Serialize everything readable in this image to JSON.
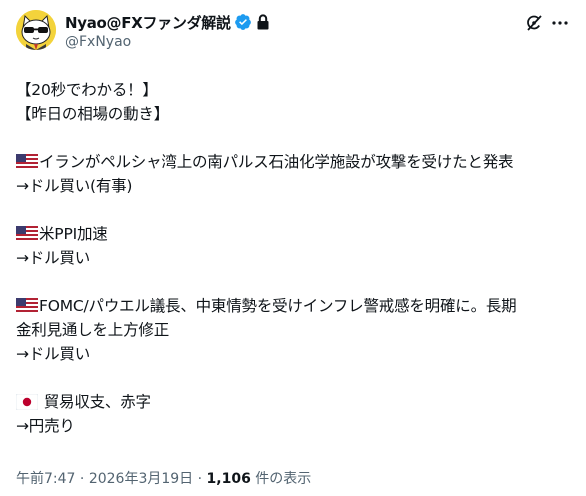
{
  "author": {
    "display_name": "Nyao@FXファンダ解説",
    "handle": "@FxNyao",
    "avatar": "cat-in-sunglasses-avatar",
    "verified_icon": "verified-badge-icon",
    "protected_icon": "lock-icon"
  },
  "actions": {
    "grok_icon": "grok-icon",
    "more_icon": "more-icon"
  },
  "post": {
    "title1": "【20秒でわかる！】",
    "title2": "【昨日の相場の動き】",
    "items": [
      {
        "flag": "us-flag-icon",
        "text": "イランがペルシャ湾上の南パルス石油化学施設が攻撃を受けたと発表"
      },
      {
        "text": "→ドル買い(有事)"
      },
      {
        "flag": "us-flag-icon",
        "text": "米PPI加速"
      },
      {
        "text": "→ドル買い"
      },
      {
        "flag": "us-flag-icon",
        "text": "FOMC/パウエル議長、中東情勢を受けインフレ警戒感を明確に。長期"
      },
      {
        "text": "金利見通しを上方修正"
      },
      {
        "text": "→ドル買い"
      },
      {
        "flag": "jp-flag-icon",
        "text": " 貿易収支、赤字"
      },
      {
        "text": "→円売り"
      }
    ]
  },
  "meta": {
    "time": "午前7:47",
    "separator1": " · ",
    "date": "2026年3月19日",
    "separator2": " · ",
    "views_count": "1,106",
    "views_label": " 件の表示"
  },
  "colors": {
    "text": "#0f1419",
    "secondary": "#536471",
    "verified": "#1d9bf0",
    "avatar_bg": "#f3d33b"
  }
}
